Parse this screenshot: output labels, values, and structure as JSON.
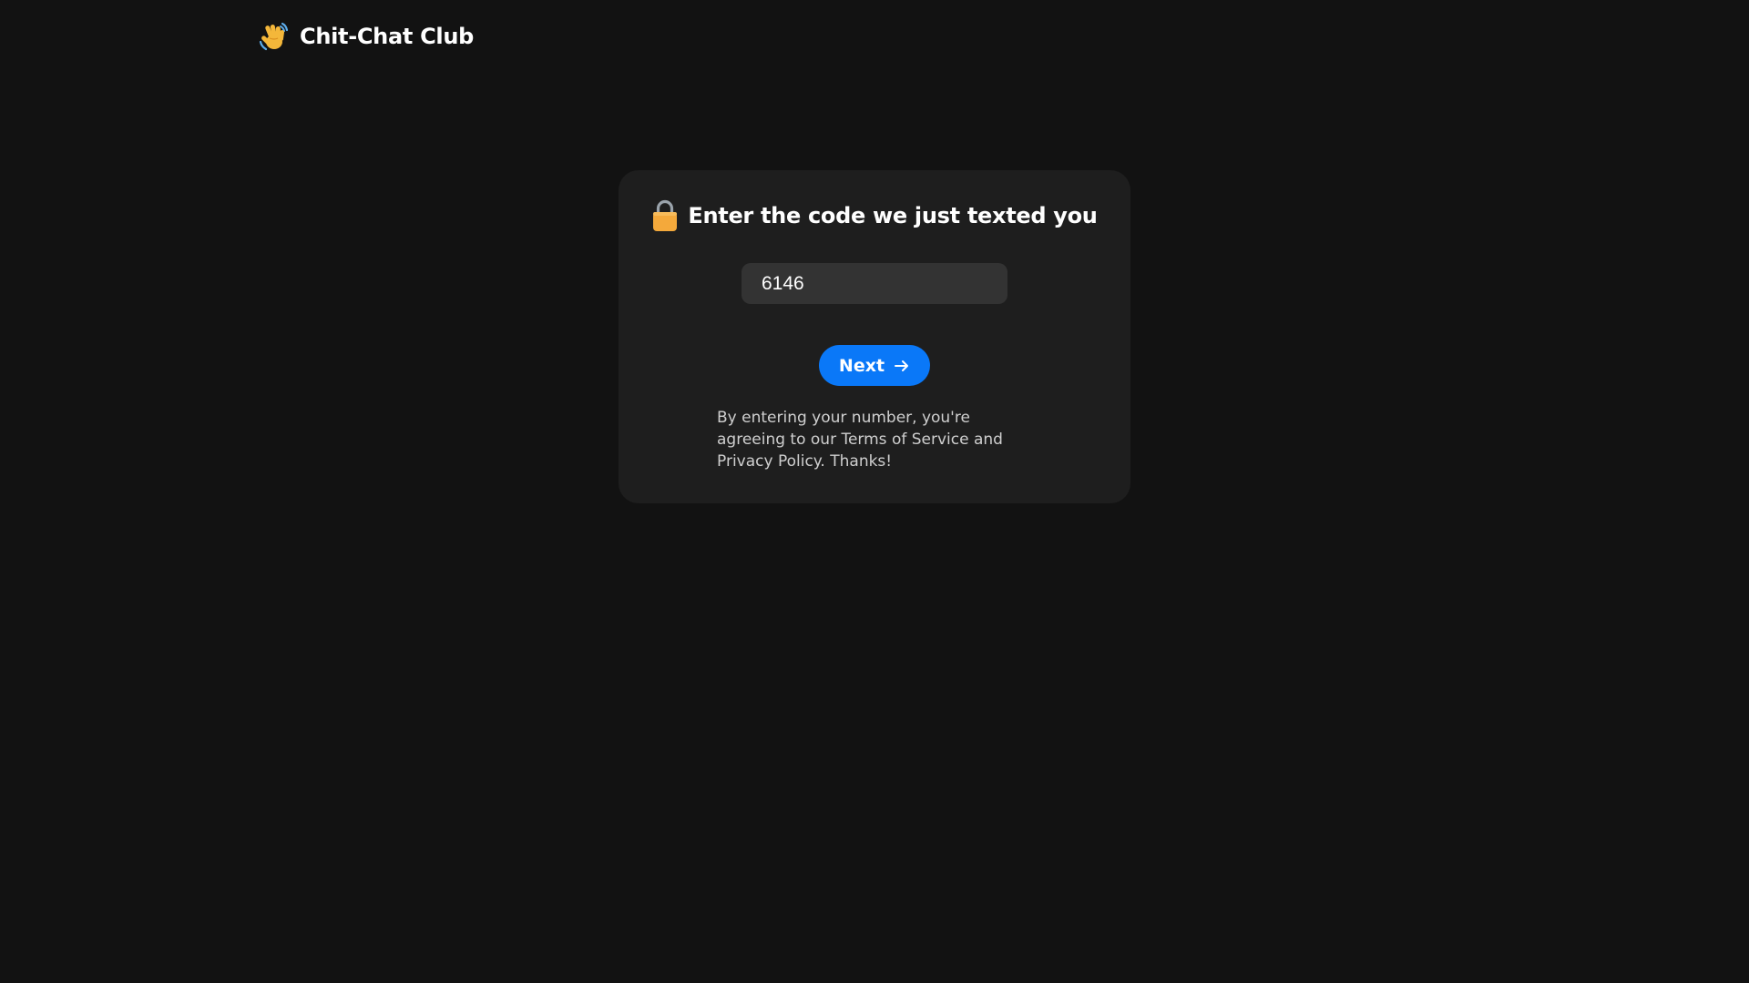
{
  "header": {
    "icon": "waving-hand-icon",
    "brand": "Chit-Chat Club"
  },
  "card": {
    "icon": "lock-icon",
    "title": "Enter the code we just texted you",
    "code_input": {
      "value": "6146",
      "placeholder": ""
    },
    "next_button": {
      "label": "Next",
      "icon": "arrow-right-icon"
    },
    "legal_text": "By entering your number, you're agreeing to our Terms of Service and Privacy Policy. Thanks!"
  },
  "colors": {
    "background": "#121212",
    "card": "#1e1e1e",
    "input": "#333333",
    "accent": "#0a78f8",
    "lock": "#f4a93b"
  }
}
